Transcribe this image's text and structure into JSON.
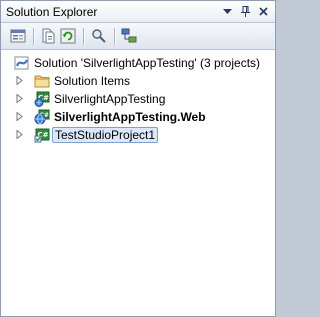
{
  "window": {
    "title": "Solution Explorer",
    "title_buttons": [
      {
        "name": "window-position-dropdown",
        "glyph": "▼"
      },
      {
        "name": "auto-hide-pin",
        "glyph": "📌"
      },
      {
        "name": "close",
        "glyph": "✕"
      }
    ]
  },
  "toolbar": {
    "buttons": [
      {
        "name": "properties-icon"
      },
      {
        "name": "show-all-files-icon"
      },
      {
        "name": "refresh-icon"
      },
      {
        "name": "view-code-icon"
      },
      {
        "name": "class-view-icon"
      }
    ]
  },
  "tree": {
    "solution_label": "Solution 'SilverlightAppTesting' (3 projects)",
    "items": [
      {
        "label": "Solution Items",
        "icon": "folder-icon",
        "bold": false,
        "selected": false
      },
      {
        "label": "SilverlightAppTesting",
        "icon": "csharp-project-icon",
        "bold": false,
        "selected": false
      },
      {
        "label": "SilverlightAppTesting.Web",
        "icon": "web-project-icon",
        "bold": true,
        "selected": false
      },
      {
        "label": "TestStudioProject1",
        "icon": "test-project-icon",
        "bold": false,
        "selected": true
      }
    ]
  },
  "colors": {
    "selection_bg": "#dbe8fa",
    "selection_border": "#7da2ce",
    "panel_border": "#8e9bb0"
  }
}
